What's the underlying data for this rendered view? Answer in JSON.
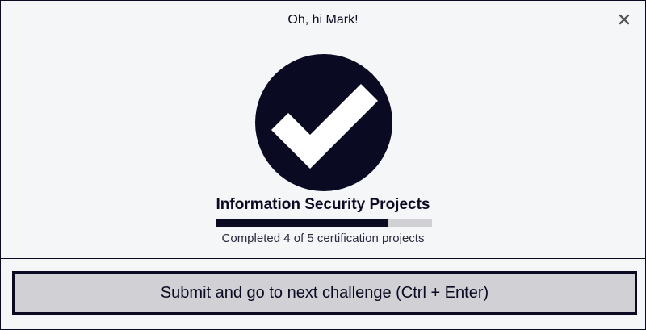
{
  "header": {
    "title": "Oh, hi Mark!",
    "close_icon": "close-icon",
    "close_glyph": "×"
  },
  "certification": {
    "icon": "checkmark-icon",
    "title": "Information Security Projects",
    "completed": 4,
    "total": 5,
    "progress_fraction": 0.8,
    "progress_text": "Completed 4 of 5 certification projects"
  },
  "footer": {
    "submit_label": "Submit and go to next challenge (Ctrl + Enter)"
  },
  "colors": {
    "primary": "#0a0a23",
    "background": "#f5f6f7",
    "button_bg": "#d0d0d5",
    "progress_track": "#d0d0d5"
  }
}
